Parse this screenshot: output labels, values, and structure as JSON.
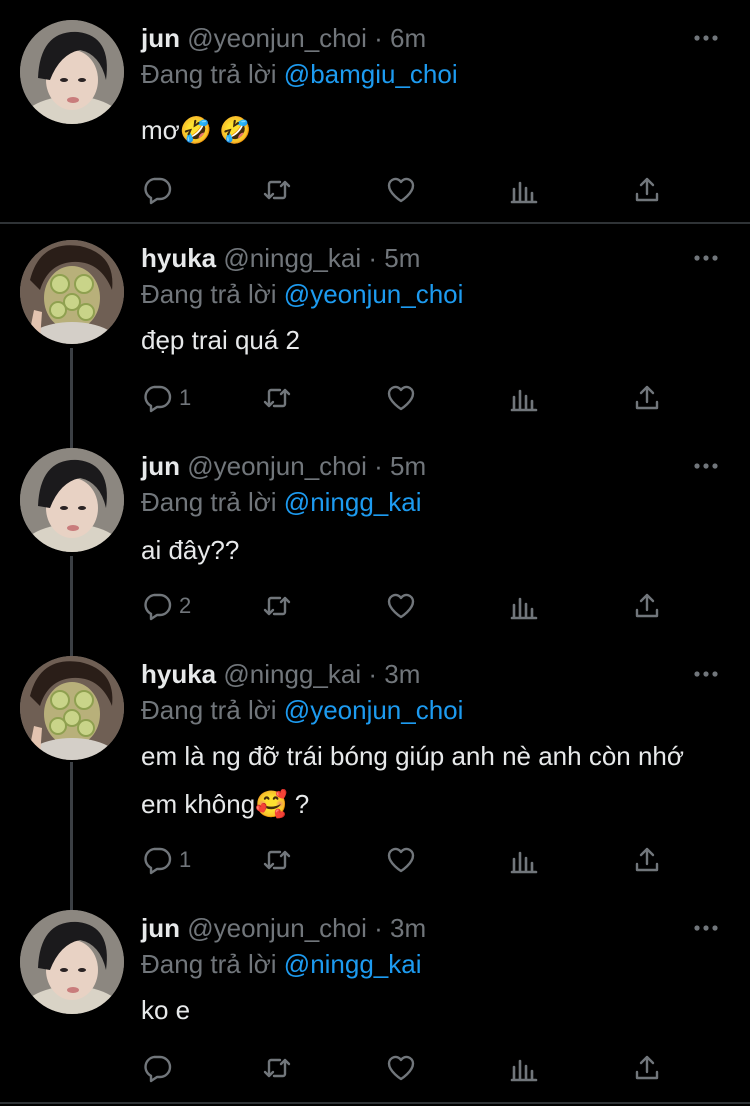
{
  "tweets": [
    {
      "name": "jun",
      "handle": "@yeonjun_choi",
      "time": "6m",
      "reply_prefix": "Đang trả lời",
      "reply_to": "@bamgiu_choi",
      "text": "mơ🤣 🤣",
      "reply_count": "",
      "avatar": "jun"
    },
    {
      "name": "hyuka",
      "handle": "@ningg_kai",
      "time": "5m",
      "reply_prefix": "Đang trả lời",
      "reply_to": "@yeonjun_choi",
      "text": "đẹp trai quá 2",
      "reply_count": "1",
      "avatar": "hyuka"
    },
    {
      "name": "jun",
      "handle": "@yeonjun_choi",
      "time": "5m",
      "reply_prefix": "Đang trả lời",
      "reply_to": "@ningg_kai",
      "text": "ai đây??",
      "reply_count": "2",
      "avatar": "jun"
    },
    {
      "name": "hyuka",
      "handle": "@ningg_kai",
      "time": "3m",
      "reply_prefix": "Đang trả lời",
      "reply_to": "@yeonjun_choi",
      "text": "em là ng đỡ trái bóng giúp anh nè anh còn nhớ em không🥰 ?",
      "reply_count": "1",
      "avatar": "hyuka"
    },
    {
      "name": "jun",
      "handle": "@yeonjun_choi",
      "time": "3m",
      "reply_prefix": "Đang trả lời",
      "reply_to": "@ningg_kai",
      "text": "ko e",
      "reply_count": "",
      "avatar": "jun"
    }
  ],
  "separator": "·",
  "colors": {
    "background": "#000000",
    "text": "#e7e9ea",
    "muted": "#71767b",
    "link": "#1d9bf0",
    "divider": "#2f3336"
  },
  "icons": [
    "reply-icon",
    "retweet-icon",
    "like-icon",
    "analytics-icon",
    "share-icon",
    "more-icon"
  ]
}
